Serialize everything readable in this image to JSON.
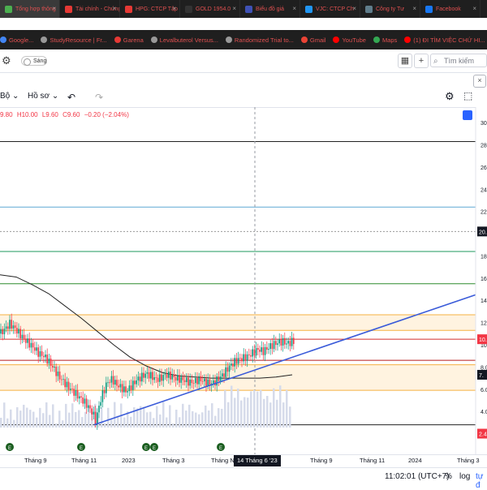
{
  "browser": {
    "tabs": [
      {
        "label": "Tổng hợp thông",
        "color": "#4caf50"
      },
      {
        "label": "Tài chính - Chứng",
        "color": "#e53935"
      },
      {
        "label": "HPG: CTCP Tập",
        "color": "#e53935"
      },
      {
        "label": "GOLD 1954.0",
        "color": "#333333",
        "icon": "TV"
      },
      {
        "label": "Biểu đồ giá",
        "color": "#3f51b5",
        "icon": "W"
      },
      {
        "label": "VJC: CTCP Ch",
        "color": "#2196f3"
      },
      {
        "label": "Công ty Tư",
        "color": "#607d8b"
      },
      {
        "label": "Facebook",
        "color": "#1877f2"
      }
    ],
    "bookmarks": [
      {
        "label": "Google...",
        "color": "#4285f4"
      },
      {
        "label": "StudyResource | Fr...",
        "color": "#999999"
      },
      {
        "label": "Garena",
        "color": "#e53935"
      },
      {
        "label": "Levalbuterol Versus...",
        "color": "#999999"
      },
      {
        "label": "Randomized Trial to...",
        "color": "#999999"
      },
      {
        "label": "Gmail",
        "color": "#ea4335"
      },
      {
        "label": "YouTube",
        "color": "#ff0000"
      },
      {
        "label": "Maps",
        "color": "#34a853"
      },
      {
        "label": "(1) ĐI TÌM VIỆC CHỨ HI...",
        "color": "#ff0000"
      },
      {
        "label": "Chrome Browser",
        "color": "#999999"
      }
    ]
  },
  "toolbar": {
    "toggle_label": "Sáng",
    "search_placeholder": "Tìm kiếm"
  },
  "chartbar": {
    "indicators_label": "Bộ",
    "templates_label": "Hồ sơ"
  },
  "ohlc": {
    "open": "9.80",
    "high": "H10.00",
    "low": "L9.60",
    "close": "C9.60",
    "change": "−0.20 (−2.04%)"
  },
  "price_axis": {
    "ticks": [
      "30.00",
      "28.00",
      "26.00",
      "24.00",
      "22.00",
      "20.00",
      "18.00",
      "16.00",
      "14.00",
      "12.00",
      "10.00",
      "8.00",
      "6.00",
      "4.00",
      "2.00"
    ],
    "current_price_label": "10.",
    "crosshair_price_label": "20.",
    "level_label_1": "7.",
    "level_label_2": "2.4"
  },
  "time_axis": {
    "labels": [
      "Tháng 9",
      "Tháng 11",
      "2023",
      "Tháng 3",
      "Tháng Năm",
      "Tháng 9",
      "Tháng 11",
      "2024",
      "Tháng 3"
    ],
    "crosshair_label": "14 Tháng 6 '23"
  },
  "bottombar": {
    "time": "11:02:01 (UTC+7)",
    "pct_label": "%",
    "log_label": "log",
    "auto_label": "tự đ"
  },
  "chart_data": {
    "type": "candlestick",
    "title": "",
    "ylim": [
      1.6,
      31.4
    ],
    "price_levels_horizontal": [
      28.3,
      22.4,
      20.2,
      18.4,
      15.5,
      10.5,
      8.6,
      2.8
    ],
    "zones": [
      {
        "from": 11.3,
        "to": 12.7,
        "color": "#fff3e0"
      },
      {
        "from": 5.9,
        "to": 8.2,
        "color": "#fff3e0"
      }
    ],
    "trendline": {
      "from": {
        "date": "2022-11",
        "price": 2.8
      },
      "to": {
        "date": "2024-03",
        "price": 14.5
      }
    },
    "ma_series_color": "#222222",
    "candle_up_color": "#089981",
    "candle_down_color": "#f23645",
    "current_price": 9.6,
    "crosshair_price": 20.2,
    "crosshair_date": "14 Tháng 6 '23",
    "price_path": [
      [
        0,
        11.0
      ],
      [
        6,
        11.4
      ],
      [
        12,
        11.9
      ],
      [
        18,
        11.5
      ],
      [
        24,
        11.0
      ],
      [
        30,
        10.5
      ],
      [
        36,
        10.1
      ],
      [
        42,
        9.7
      ],
      [
        48,
        9.2
      ],
      [
        54,
        9.0
      ],
      [
        60,
        8.5
      ],
      [
        66,
        7.9
      ],
      [
        72,
        7.2
      ],
      [
        78,
        6.7
      ],
      [
        84,
        6.2
      ],
      [
        90,
        5.8
      ],
      [
        96,
        5.4
      ],
      [
        102,
        5.0
      ],
      [
        108,
        4.5
      ],
      [
        114,
        3.9
      ],
      [
        118,
        3.1
      ],
      [
        122,
        4.5
      ],
      [
        126,
        5.5
      ],
      [
        132,
        6.6
      ],
      [
        138,
        6.9
      ],
      [
        144,
        6.4
      ],
      [
        150,
        6.1
      ],
      [
        156,
        5.8
      ],
      [
        162,
        6.3
      ],
      [
        168,
        6.8
      ],
      [
        174,
        7.1
      ],
      [
        180,
        7.4
      ],
      [
        186,
        7.2
      ],
      [
        192,
        6.9
      ],
      [
        198,
        7.0
      ],
      [
        204,
        7.3
      ],
      [
        210,
        7.2
      ],
      [
        216,
        7.0
      ],
      [
        222,
        6.9
      ],
      [
        228,
        6.8
      ],
      [
        234,
        6.6
      ],
      [
        240,
        6.7
      ],
      [
        246,
        6.9
      ],
      [
        252,
        6.7
      ],
      [
        258,
        6.5
      ],
      [
        264,
        6.6
      ],
      [
        270,
        7.0
      ],
      [
        276,
        7.4
      ],
      [
        282,
        8.0
      ],
      [
        288,
        8.4
      ],
      [
        294,
        8.7
      ],
      [
        300,
        8.8
      ],
      [
        306,
        9.0
      ],
      [
        312,
        9.3
      ],
      [
        318,
        9.6
      ],
      [
        324,
        9.4
      ],
      [
        330,
        9.7
      ],
      [
        336,
        10.0
      ],
      [
        342,
        10.2
      ],
      [
        348,
        10.3
      ],
      [
        354,
        10.1
      ],
      [
        360,
        10.3
      ]
    ],
    "ma_path": [
      [
        0,
        16.3
      ],
      [
        20,
        16.1
      ],
      [
        40,
        15.4
      ],
      [
        60,
        14.6
      ],
      [
        80,
        13.5
      ],
      [
        100,
        12.4
      ],
      [
        120,
        11.2
      ],
      [
        140,
        10.0
      ],
      [
        160,
        8.9
      ],
      [
        180,
        8.1
      ],
      [
        200,
        7.5
      ],
      [
        220,
        7.2
      ],
      [
        240,
        7.1
      ],
      [
        260,
        7.0
      ],
      [
        280,
        7.0
      ],
      [
        300,
        7.0
      ],
      [
        320,
        7.0
      ],
      [
        340,
        7.1
      ],
      [
        360,
        7.3
      ]
    ],
    "volume_bar_color": "#d6dbea"
  }
}
